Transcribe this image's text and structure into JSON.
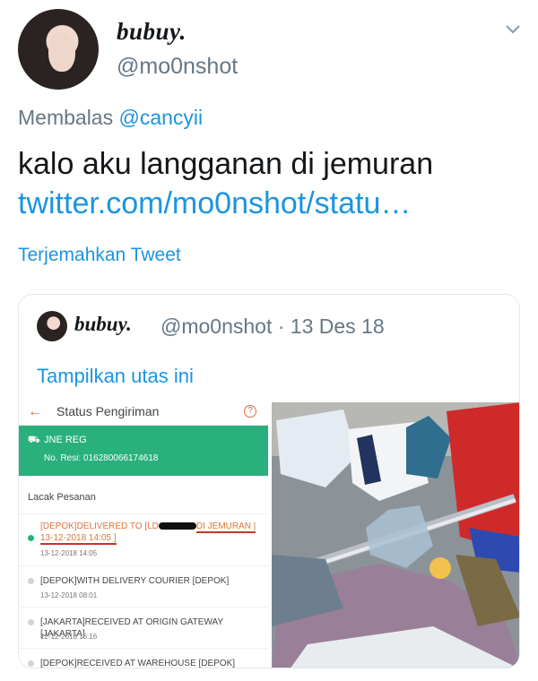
{
  "tweet": {
    "display_name": "bubuy.",
    "handle": "@mo0nshot",
    "reply_prefix": "Membalas",
    "reply_mention": "@cancyii",
    "text": "kalo aku langganan di jemuran",
    "link": "twitter.com/mo0nshot/statu…",
    "translate": "Terjemahkan Tweet"
  },
  "quote": {
    "display_name": "bubuy.",
    "handle_date": "@mo0nshot · 13 Des 18",
    "show_thread": "Tampilkan utas ini"
  },
  "shipping": {
    "title": "Status Pengiriman",
    "courier": "JNE REG",
    "resi": "No. Resi: 016280066174618",
    "section": "Lacak Pesanan",
    "events": [
      {
        "text_a": "[DEPOK]DELIVERED TO [LD",
        "text_b": "DI JEMURAN | 13-12-2018 14:05 ]",
        "time": "13-12-2018 14:05"
      },
      {
        "text": "[DEPOK]WITH DELIVERY COURIER [DEPOK]",
        "time": "13-12-2018 08:01"
      },
      {
        "text": "[JAKARTA]RECEIVED AT ORIGIN GATEWAY [JAKARTA]",
        "time": "12-12-2018 16:16"
      },
      {
        "text": "[DEPOK]RECEIVED AT WAREHOUSE [DEPOK]"
      }
    ]
  },
  "colors": {
    "link": "#1b95e0",
    "secondary": "#657786",
    "shipping_green": "#2ab07c",
    "highlight": "#e0743c"
  },
  "icons": {
    "caret": "chevron-down-icon",
    "truck": "truck-icon",
    "back": "arrow-left-icon",
    "help": "help-icon"
  }
}
